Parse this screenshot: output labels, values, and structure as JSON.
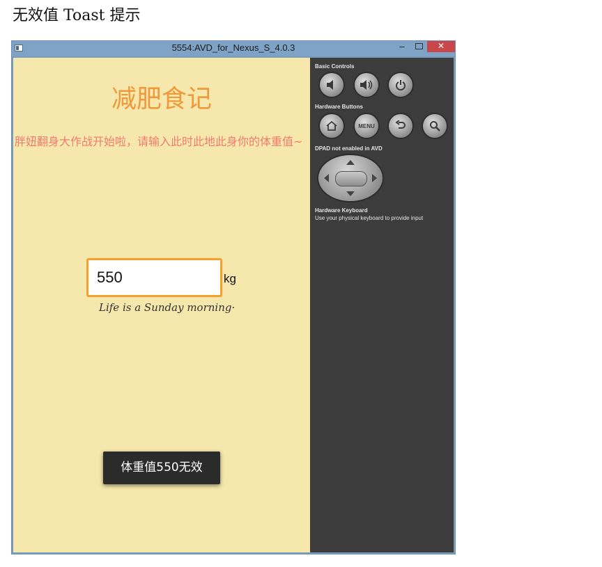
{
  "caption": "无效值 Toast 提示",
  "window": {
    "title": "5554:AVD_for_Nexus_S_4.0.3",
    "minimize_glyph": "–",
    "close_glyph": "✕"
  },
  "app": {
    "title": "减肥食记",
    "prompt": "胖妞翻身大作战开始啦，请输入此时此地此身你的体重值~",
    "weight_value": "550",
    "unit": "kg",
    "tagline": "Life is a Sunday morning·",
    "toast": "体重值550无效",
    "background_color": "#f6e8ac",
    "title_color": "#ee9a3c",
    "prompt_color": "#ef7b71",
    "input_border_color": "#f5a02a"
  },
  "controls": {
    "basic_label": "Basic Controls",
    "hardware_label": "Hardware Buttons",
    "dpad_label": "DPAD not enabled in AVD",
    "keyboard_title": "Hardware Keyboard",
    "keyboard_hint": "Use your physical keyboard to provide input",
    "menu_label": "MENU",
    "icons": [
      "volume-down-icon",
      "volume-up-icon",
      "power-icon",
      "home-icon",
      "menu-icon",
      "back-icon",
      "search-icon"
    ]
  }
}
